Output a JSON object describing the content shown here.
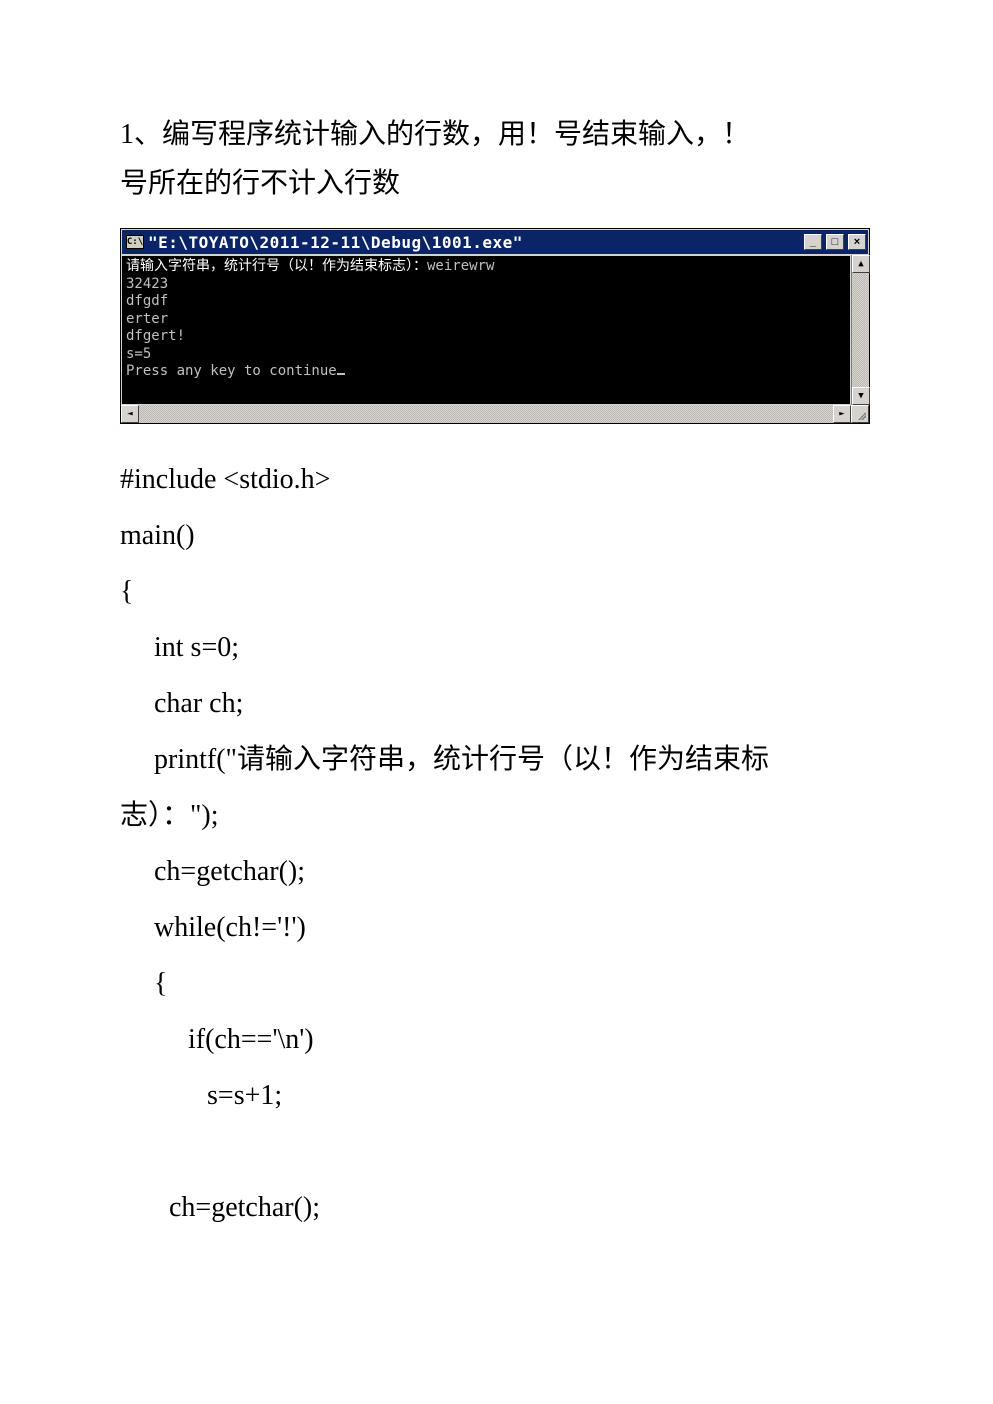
{
  "problem": {
    "line1": "1、编写程序统计输入的行数，用！号结束输入，！",
    "line2": "号所在的行不计入行数"
  },
  "console": {
    "icon_label": "C:\\",
    "title": "\"E:\\TOYATO\\2011-12-11\\Debug\\1001.exe\"",
    "out_prompt_hl": "请输入字符串，统计行号（以！作为结束标志）：",
    "out_prompt_tail": "weirewrw",
    "lines": [
      "32423",
      "dfgdf",
      "erter",
      "dfgert!",
      "s=5",
      "Press any key to continue"
    ]
  },
  "code": {
    "l1": "#include <stdio.h>",
    "l2": "main()",
    "l3": "{",
    "l4": "int s=0;",
    "l5": "char ch;",
    "l6a": "printf(\"请输入字符串，统计行号（以！作为结束标",
    "l6b": "志）：\");",
    "l7": "ch=getchar();",
    "l8": "while(ch!='!')",
    "l9": "{",
    "l10": "if(ch=='\\n')",
    "l11": " s=s+1;",
    "l12": " ch=getchar();"
  }
}
